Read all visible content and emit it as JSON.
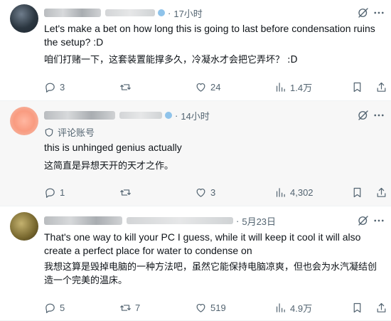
{
  "tweets": [
    {
      "time": "17小时",
      "text_en": "Let's make a bet on how long this is going to last before condensation ruins the setup? :D",
      "text_zh": "咱们打赌一下，这套装置能撑多久，冷凝水才会把它弄坏？ :D",
      "replies": "3",
      "retweets": "",
      "likes": "24",
      "views": "1.4万"
    },
    {
      "time": "14小时",
      "note": "评论账号",
      "text_en": "this is unhinged genius actually",
      "text_zh": "这简直是异想天开的天才之作。",
      "replies": "1",
      "retweets": "",
      "likes": "3",
      "views": "4,302"
    },
    {
      "time": "5月23日",
      "text_en": "That's one way to kill your PC I guess, while it will keep it cool it will also create a perfect place for water to condense on",
      "text_zh": "我想这算是毁掉电脑的一种方法吧，虽然它能保持电脑凉爽，但也会为水汽凝结创造一个完美的温床。",
      "replies": "5",
      "retweets": "7",
      "likes": "519",
      "views": "4.9万"
    }
  ],
  "icons": {
    "reply": "reply-icon",
    "retweet": "retweet-icon",
    "like": "heart-icon",
    "views": "views-icon",
    "bookmark": "bookmark-icon",
    "share": "share-icon",
    "grok": "grok-icon",
    "more": "more-icon"
  },
  "colors": {
    "text": "#0f1419",
    "muted": "#536471",
    "border": "#eff3f4"
  }
}
